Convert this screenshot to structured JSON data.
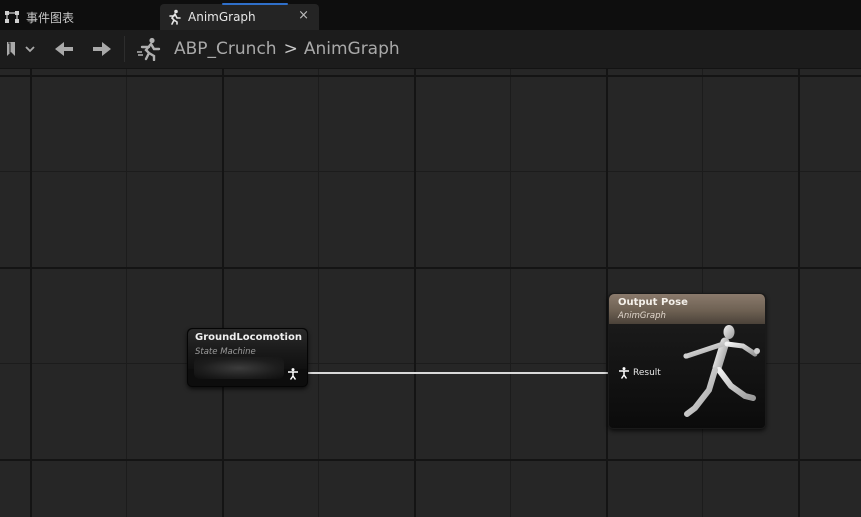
{
  "tabs": [
    {
      "label": "事件图表",
      "icon": "event-graph-icon",
      "active": false
    },
    {
      "label": "AnimGraph",
      "icon": "anim-graph-icon",
      "active": true,
      "close": "×"
    }
  ],
  "toolbar": {
    "bookmark_icon": "bookmark-icon",
    "back_icon": "arrow-left-icon",
    "forward_icon": "arrow-right-icon"
  },
  "breadcrumb": {
    "icon": "anim-blueprint-icon",
    "items": [
      "ABP_Crunch",
      "AnimGraph"
    ],
    "separator": ">"
  },
  "graph": {
    "nodes": [
      {
        "title": "GroundLocomotion",
        "subtitle": "State Machine",
        "pin_icon": "pose-pin-icon"
      },
      {
        "title": "Output Pose",
        "subtitle": "AnimGraph",
        "pin_label": "Result",
        "pin_icon": "pose-pin-icon",
        "preview": "running-mannequin"
      }
    ]
  },
  "colors": {
    "tab_accent": "#2f6fc9",
    "output_header": "#7a6b5d",
    "wire": "#d9d9d9",
    "canvas": "#262626"
  }
}
